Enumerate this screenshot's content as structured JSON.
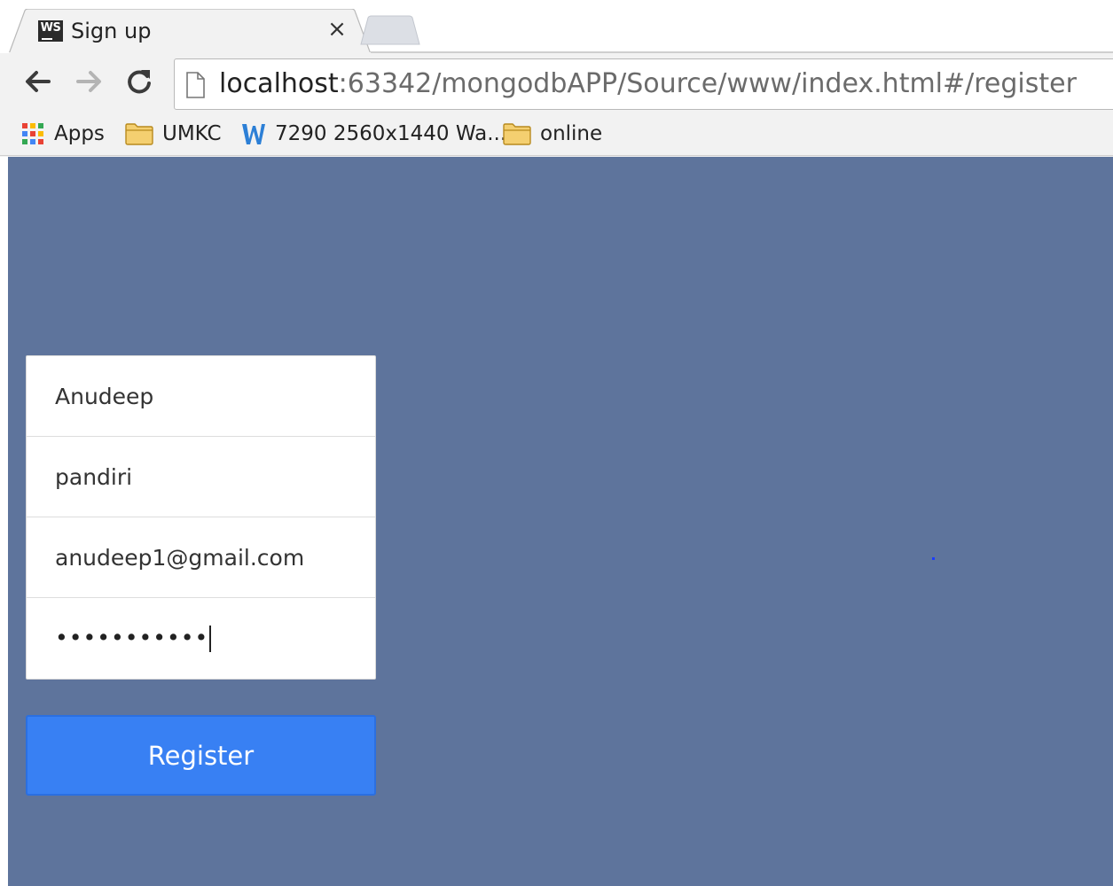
{
  "browser": {
    "tab_title": "Sign up",
    "tab_close_glyph": "×",
    "tab_favicon_text": "WS",
    "url_host": "localhost",
    "url_rest": ":63342/mongodbAPP/Source/www/index.html#/register",
    "bookmarks": [
      {
        "label": "Apps",
        "icon": "apps-grid-icon"
      },
      {
        "label": "UMKC",
        "icon": "folder-icon"
      },
      {
        "label": "7290 2560x1440 Wa...",
        "icon": "w-logo-icon"
      },
      {
        "label": "online",
        "icon": "folder-icon"
      }
    ]
  },
  "form": {
    "first_name": "Anudeep",
    "last_name": "pandiri",
    "email": "anudeep1@gmail.com",
    "password_mask": "•••••••••••",
    "register_label": "Register"
  },
  "colors": {
    "page_background": "#5e749c",
    "button": "#3880f3",
    "card": "#ffffff"
  }
}
